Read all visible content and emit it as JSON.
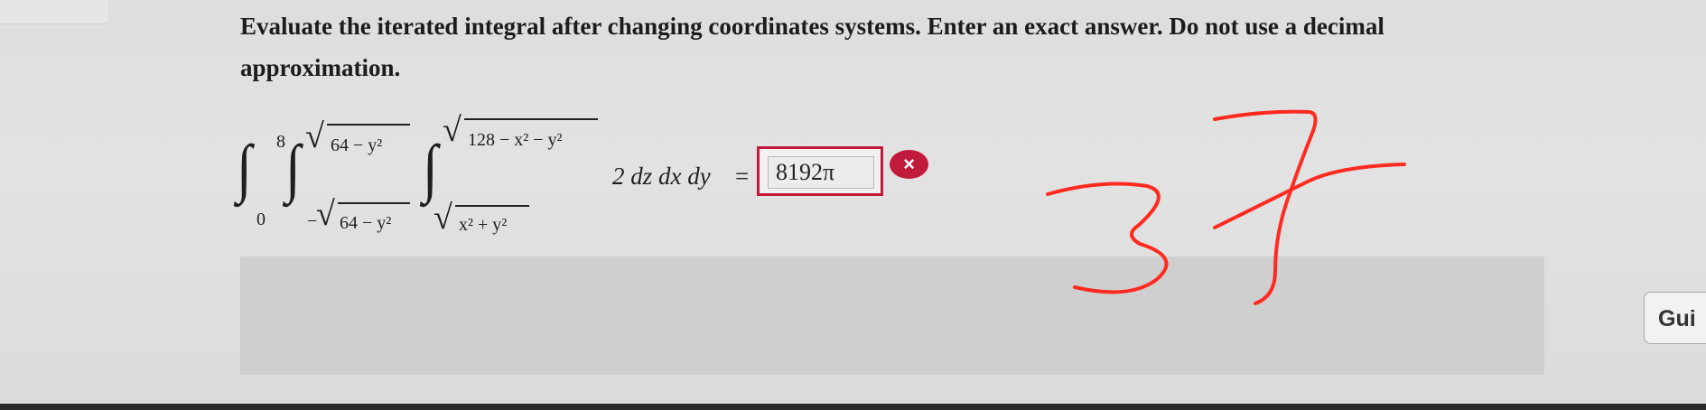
{
  "question": {
    "text": "Evaluate the iterated integral after changing coordinates systems. Enter an exact answer. Do not use a decimal approximation."
  },
  "integral": {
    "outer_lower": "0",
    "outer_upper": "8",
    "middle_lower_sign": "−",
    "middle_lower_radicand": "64 − y²",
    "middle_upper_radicand": "64 − y²",
    "inner_lower_radicand": "x² + y²",
    "inner_upper_radicand": "128 − x² − y²",
    "integrand": "2 dz dx dy",
    "equals": "="
  },
  "answer": {
    "value": "8192π",
    "status": "incorrect",
    "status_icon": "×"
  },
  "guide_button": {
    "label": "Gui"
  },
  "handwriting": {
    "text": "37",
    "color": "#ff2a1f"
  },
  "colors": {
    "error": "#c2183a",
    "panel": "#cfcfcf"
  }
}
